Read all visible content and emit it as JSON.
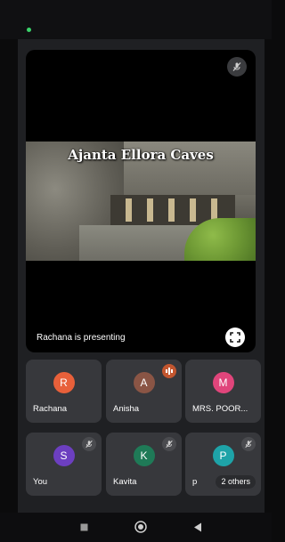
{
  "stage": {
    "slide_title": "Ajanta Ellora Caves",
    "presenting_text": "Rachana is presenting"
  },
  "participants": [
    {
      "name": "Rachana",
      "initial": "R",
      "color": "#e8603a",
      "status": "none"
    },
    {
      "name": "Anisha",
      "initial": "A",
      "color": "#8a5545",
      "status": "speaking"
    },
    {
      "name": "MRS. POOR...",
      "initial": "M",
      "color": "#e0457b",
      "status": "none"
    },
    {
      "name": "You",
      "initial": "S",
      "color": "#6c3fc0",
      "status": "muted"
    },
    {
      "name": "Kavita",
      "initial": "K",
      "color": "#1f7a57",
      "status": "muted"
    },
    {
      "name": "p",
      "initial": "P",
      "color": "#1ea3a8",
      "status": "muted",
      "others_label": "2 others"
    }
  ],
  "colors": {
    "status_dot": "#3ad36a",
    "speaking": "#c2562f"
  },
  "icons": [
    "mic-off-icon",
    "fullscreen-icon",
    "speaking-icon",
    "nav-square-icon",
    "nav-home-icon",
    "nav-back-icon"
  ]
}
